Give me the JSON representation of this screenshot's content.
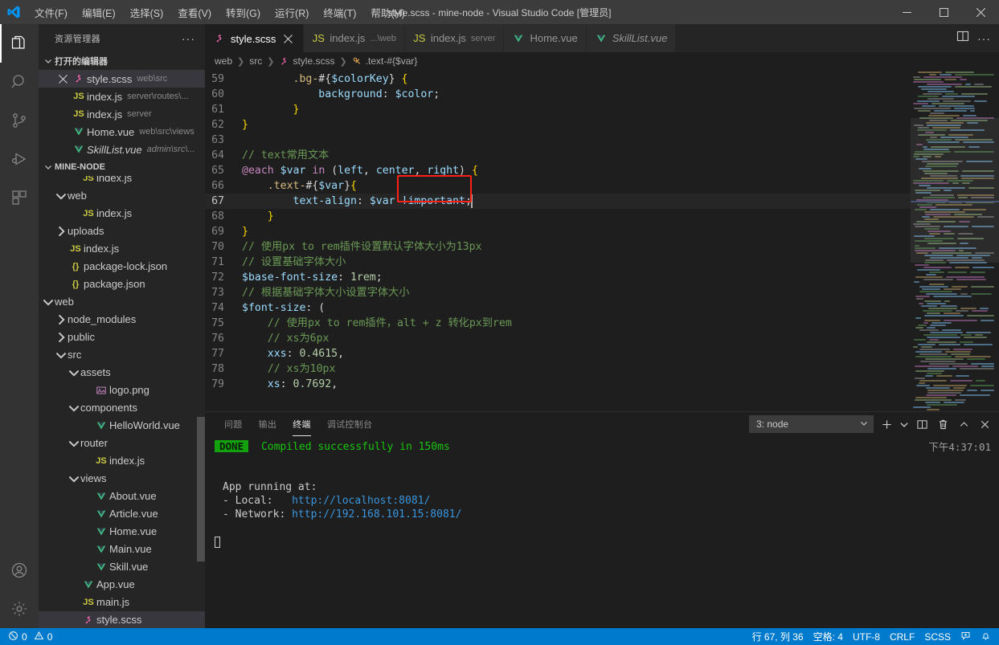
{
  "titlebar": {
    "window_title": "style.scss - mine-node - Visual Studio Code [管理员]",
    "menus": [
      "文件(F)",
      "编辑(E)",
      "选择(S)",
      "查看(V)",
      "转到(G)",
      "运行(R)",
      "终端(T)",
      "帮助(H)"
    ],
    "minimize_label": "最小化",
    "maximize_label": "最大化",
    "close_label": "关闭"
  },
  "activitybar": {
    "items": [
      {
        "name": "explorer",
        "icon": "files-icon",
        "active": true
      },
      {
        "name": "search",
        "icon": "search-icon",
        "active": false
      },
      {
        "name": "source-control",
        "icon": "source-control-icon",
        "active": false
      },
      {
        "name": "run-debug",
        "icon": "run-debug-icon",
        "active": false
      },
      {
        "name": "extensions",
        "icon": "extensions-icon",
        "active": false
      }
    ],
    "bottom": [
      {
        "name": "accounts",
        "icon": "account-icon"
      },
      {
        "name": "settings",
        "icon": "gear-icon"
      }
    ]
  },
  "sidebar": {
    "title": "资源管理器",
    "more_actions": "···",
    "open_editors": {
      "label": "打开的编辑器",
      "items": [
        {
          "name": "style.scss",
          "desc": "web\\src",
          "icon": "scss",
          "selected": true,
          "closable": true,
          "italic": false
        },
        {
          "name": "index.js",
          "desc": "server\\routes\\...",
          "icon": "js",
          "selected": false,
          "closable": false,
          "italic": false
        },
        {
          "name": "index.js",
          "desc": "server",
          "icon": "js",
          "selected": false,
          "closable": false,
          "italic": false
        },
        {
          "name": "Home.vue",
          "desc": "web\\src\\views",
          "icon": "vue",
          "selected": false,
          "closable": false,
          "italic": false
        },
        {
          "name": "SkillList.vue",
          "desc": "admin\\src\\...",
          "icon": "vue",
          "selected": false,
          "closable": false,
          "italic": true
        }
      ]
    },
    "project": {
      "label": "MINE-NODE",
      "items": [
        {
          "name": "index.js",
          "icon": "js",
          "indent": 3,
          "twisty": "",
          "clipped": true
        },
        {
          "name": "web",
          "icon": "folder",
          "indent": 2,
          "twisty": "down"
        },
        {
          "name": "index.js",
          "icon": "js",
          "indent": 3,
          "twisty": ""
        },
        {
          "name": "uploads",
          "icon": "folder",
          "indent": 2,
          "twisty": "right"
        },
        {
          "name": "index.js",
          "icon": "js",
          "indent": 2,
          "twisty": ""
        },
        {
          "name": "package-lock.json",
          "icon": "json",
          "indent": 2,
          "twisty": ""
        },
        {
          "name": "package.json",
          "icon": "json",
          "indent": 2,
          "twisty": ""
        },
        {
          "name": "web",
          "icon": "folder",
          "indent": 1,
          "twisty": "down"
        },
        {
          "name": "node_modules",
          "icon": "folder",
          "indent": 2,
          "twisty": "right"
        },
        {
          "name": "public",
          "icon": "folder",
          "indent": 2,
          "twisty": "right"
        },
        {
          "name": "src",
          "icon": "folder",
          "indent": 2,
          "twisty": "down"
        },
        {
          "name": "assets",
          "icon": "folder",
          "indent": 3,
          "twisty": "down"
        },
        {
          "name": "logo.png",
          "icon": "image",
          "indent": 4,
          "twisty": ""
        },
        {
          "name": "components",
          "icon": "folder",
          "indent": 3,
          "twisty": "down"
        },
        {
          "name": "HelloWorld.vue",
          "icon": "vue",
          "indent": 4,
          "twisty": ""
        },
        {
          "name": "router",
          "icon": "folder",
          "indent": 3,
          "twisty": "down"
        },
        {
          "name": "index.js",
          "icon": "js",
          "indent": 4,
          "twisty": ""
        },
        {
          "name": "views",
          "icon": "folder",
          "indent": 3,
          "twisty": "down"
        },
        {
          "name": "About.vue",
          "icon": "vue",
          "indent": 4,
          "twisty": ""
        },
        {
          "name": "Article.vue",
          "icon": "vue",
          "indent": 4,
          "twisty": ""
        },
        {
          "name": "Home.vue",
          "icon": "vue",
          "indent": 4,
          "twisty": ""
        },
        {
          "name": "Main.vue",
          "icon": "vue",
          "indent": 4,
          "twisty": ""
        },
        {
          "name": "Skill.vue",
          "icon": "vue",
          "indent": 4,
          "twisty": ""
        },
        {
          "name": "App.vue",
          "icon": "vue",
          "indent": 3,
          "twisty": ""
        },
        {
          "name": "main.js",
          "icon": "js",
          "indent": 3,
          "twisty": ""
        },
        {
          "name": "style.scss",
          "icon": "scss",
          "indent": 3,
          "twisty": "",
          "selected": true
        }
      ]
    }
  },
  "editor": {
    "tabs": [
      {
        "label": "style.scss",
        "desc": "",
        "icon": "scss",
        "active": true,
        "closable": true,
        "italic": false
      },
      {
        "label": "index.js",
        "desc": "...\\web",
        "icon": "js",
        "active": false,
        "closable": false,
        "italic": false
      },
      {
        "label": "index.js",
        "desc": "server",
        "icon": "js",
        "active": false,
        "closable": false,
        "italic": false
      },
      {
        "label": "Home.vue",
        "desc": "",
        "icon": "vue",
        "active": false,
        "closable": false,
        "italic": false
      },
      {
        "label": "SkillList.vue",
        "desc": "",
        "icon": "vue",
        "active": false,
        "closable": false,
        "italic": true
      }
    ],
    "tab_actions": [
      "split-editor-icon",
      "more-actions-icon"
    ],
    "breadcrumb": [
      "web",
      "src",
      "style.scss",
      ".text-#{$var}"
    ],
    "lines": [
      {
        "n": 59,
        "tokens": [
          {
            "t": "        ",
            "c": "t-pun"
          },
          {
            "t": ".bg-",
            "c": "t-sel"
          },
          {
            "t": "#{",
            "c": "t-pun"
          },
          {
            "t": "$colorKey",
            "c": "t-var"
          },
          {
            "t": "} ",
            "c": "t-pun"
          },
          {
            "t": "{",
            "c": "t-brace1"
          }
        ]
      },
      {
        "n": 60,
        "tokens": [
          {
            "t": "            ",
            "c": "t-pun"
          },
          {
            "t": "background",
            "c": "t-prop"
          },
          {
            "t": ": ",
            "c": "t-pun"
          },
          {
            "t": "$color",
            "c": "t-var"
          },
          {
            "t": ";",
            "c": "t-pun"
          }
        ]
      },
      {
        "n": 61,
        "tokens": [
          {
            "t": "        ",
            "c": "t-pun"
          },
          {
            "t": "}",
            "c": "t-brace1"
          }
        ]
      },
      {
        "n": 62,
        "tokens": [
          {
            "t": "}",
            "c": "t-brace1"
          }
        ]
      },
      {
        "n": 63,
        "tokens": []
      },
      {
        "n": 64,
        "tokens": [
          {
            "t": "// text常用文本",
            "c": "t-cmt"
          }
        ]
      },
      {
        "n": 65,
        "tokens": [
          {
            "t": "@each",
            "c": "t-kw"
          },
          {
            "t": " ",
            "c": "t-pun"
          },
          {
            "t": "$var",
            "c": "t-var"
          },
          {
            "t": " ",
            "c": "t-pun"
          },
          {
            "t": "in",
            "c": "t-kw"
          },
          {
            "t": " (",
            "c": "t-pun"
          },
          {
            "t": "left",
            "c": "t-var"
          },
          {
            "t": ", ",
            "c": "t-pun"
          },
          {
            "t": "center",
            "c": "t-var"
          },
          {
            "t": ", ",
            "c": "t-pun"
          },
          {
            "t": "right",
            "c": "t-var"
          },
          {
            "t": ") ",
            "c": "t-pun"
          },
          {
            "t": "{",
            "c": "t-brace1"
          }
        ]
      },
      {
        "n": 66,
        "tokens": [
          {
            "t": "    ",
            "c": "t-pun"
          },
          {
            "t": ".text-",
            "c": "t-sel"
          },
          {
            "t": "#{",
            "c": "t-pun"
          },
          {
            "t": "$var",
            "c": "t-var"
          },
          {
            "t": "}",
            "c": "t-pun"
          },
          {
            "t": "{",
            "c": "t-brace1"
          }
        ]
      },
      {
        "n": 67,
        "tokens": [
          {
            "t": "        ",
            "c": "t-pun"
          },
          {
            "t": "text-align",
            "c": "t-prop"
          },
          {
            "t": ": ",
            "c": "t-pun"
          },
          {
            "t": "$var",
            "c": "t-var"
          },
          {
            "t": " ",
            "c": "t-pun"
          },
          {
            "t": "!important",
            "c": "t-prop"
          },
          {
            "t": ";",
            "c": "t-pun"
          }
        ],
        "current": true
      },
      {
        "n": 68,
        "tokens": [
          {
            "t": "    ",
            "c": "t-pun"
          },
          {
            "t": "}",
            "c": "t-brace1"
          }
        ]
      },
      {
        "n": 69,
        "tokens": [
          {
            "t": "}",
            "c": "t-brace1"
          }
        ]
      },
      {
        "n": 70,
        "tokens": [
          {
            "t": "// 使用px to rem插件设置默认字体大小为13px",
            "c": "t-cmt"
          }
        ]
      },
      {
        "n": 71,
        "tokens": [
          {
            "t": "// 设置基础字体大小",
            "c": "t-cmt"
          }
        ]
      },
      {
        "n": 72,
        "tokens": [
          {
            "t": "$base-font-size",
            "c": "t-var"
          },
          {
            "t": ": ",
            "c": "t-pun"
          },
          {
            "t": "1rem",
            "c": "t-num"
          },
          {
            "t": ";",
            "c": "t-pun"
          }
        ]
      },
      {
        "n": 73,
        "tokens": [
          {
            "t": "// 根据基础字体大小设置字体大小",
            "c": "t-cmt"
          }
        ]
      },
      {
        "n": 74,
        "tokens": [
          {
            "t": "$font-size",
            "c": "t-var"
          },
          {
            "t": ": (",
            "c": "t-pun"
          }
        ]
      },
      {
        "n": 75,
        "tokens": [
          {
            "t": "    ",
            "c": "t-pun"
          },
          {
            "t": "// 使用px to rem插件，alt + z 转化px到rem",
            "c": "t-cmt"
          }
        ]
      },
      {
        "n": 76,
        "tokens": [
          {
            "t": "    ",
            "c": "t-pun"
          },
          {
            "t": "// xs为6px",
            "c": "t-cmt"
          }
        ]
      },
      {
        "n": 77,
        "tokens": [
          {
            "t": "    ",
            "c": "t-pun"
          },
          {
            "t": "xxs",
            "c": "t-prop"
          },
          {
            "t": ": ",
            "c": "t-pun"
          },
          {
            "t": "0.4615",
            "c": "t-num"
          },
          {
            "t": ",",
            "c": "t-pun"
          }
        ]
      },
      {
        "n": 78,
        "tokens": [
          {
            "t": "    ",
            "c": "t-pun"
          },
          {
            "t": "// xs为10px",
            "c": "t-cmt"
          }
        ]
      },
      {
        "n": 79,
        "tokens": [
          {
            "t": "    ",
            "c": "t-pun"
          },
          {
            "t": "xs",
            "c": "t-prop"
          },
          {
            "t": ": ",
            "c": "t-pun"
          },
          {
            "t": "0.7692",
            "c": "t-num"
          },
          {
            "t": ",",
            "c": "t-pun"
          }
        ]
      }
    ],
    "annotation": {
      "color": "#ff2116",
      "target": "!important"
    }
  },
  "panel": {
    "tabs": [
      "问题",
      "输出",
      "终端",
      "调试控制台"
    ],
    "active_tab": "终端",
    "terminal_select": "3: node",
    "actions": [
      "new-terminal-icon",
      "split-terminal-icon",
      "kill-terminal-icon",
      "maximize-panel-icon",
      "close-panel-icon"
    ],
    "timestamp": "下午4:37:01",
    "output": {
      "badge": "DONE",
      "badge_text": "Compiled successfully in 150ms",
      "heading": "App running at:",
      "local_label": "- Local:",
      "local_url": "http://localhost:8081/",
      "network_label": "- Network:",
      "network_url": "http://192.168.101.15:8081/"
    }
  },
  "statusbar": {
    "errors": "0",
    "warnings": "0",
    "cursor": "行 67, 列 36",
    "indent": "空格: 4",
    "encoding": "UTF-8",
    "eol": "CRLF",
    "language": "SCSS",
    "feedback_icon": "feedback-icon",
    "bell_icon": "bell-icon",
    "accent": "#007acc"
  }
}
